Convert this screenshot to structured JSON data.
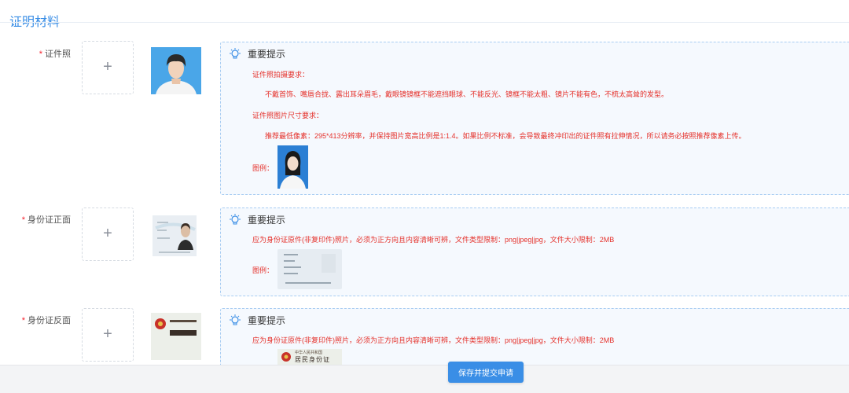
{
  "section_title": "证明材料",
  "required_mark": "*",
  "rows": [
    {
      "label": "证件照",
      "tip_title": "重要提示",
      "photo_req_title": "证件照拍摄要求：",
      "photo_req_text": "不戴首饰、嘴唇合拢、露出耳朵眉毛，戴眼镜镜框不能遮挡眼球、不能反光、镜框不能太粗、镜片不能有色，不梳太高耸的发型。",
      "size_req_title": "证件照图片尺寸要求：",
      "size_req_text": "推荐最低像素：295*413分辨率，并保持图片宽高比例是1:1.4。如果比例不标准，会导致最终冲印出的证件照有拉伸情况，所以请务必按照推荐像素上传。",
      "example_label": "图例："
    },
    {
      "label": "身份证正面",
      "tip_title": "重要提示",
      "tip_text": "应为身份证原件(非复印件)照片，必须为正方向且内容清晰可辨，文件类型限制：png|jpeg|jpg，文件大小限制：2MB",
      "example_label": "图例："
    },
    {
      "label": "身份证反面",
      "tip_title": "重要提示",
      "tip_text": "应为身份证原件(非复印件)照片，必须为正方向且内容清晰可辨，文件类型限制：png|jpeg|jpg，文件大小限制：2MB"
    }
  ],
  "upload_symbol": "+",
  "id_card_back": {
    "line1": "中华人民共和国",
    "line2": "居民身份证"
  },
  "submit_label": "保存并提交申请",
  "colors": {
    "accent": "#3a8ee6",
    "warning_text": "#e5312b",
    "tip_border": "#a9cdf2",
    "tip_bg": "#f5f9fe"
  }
}
